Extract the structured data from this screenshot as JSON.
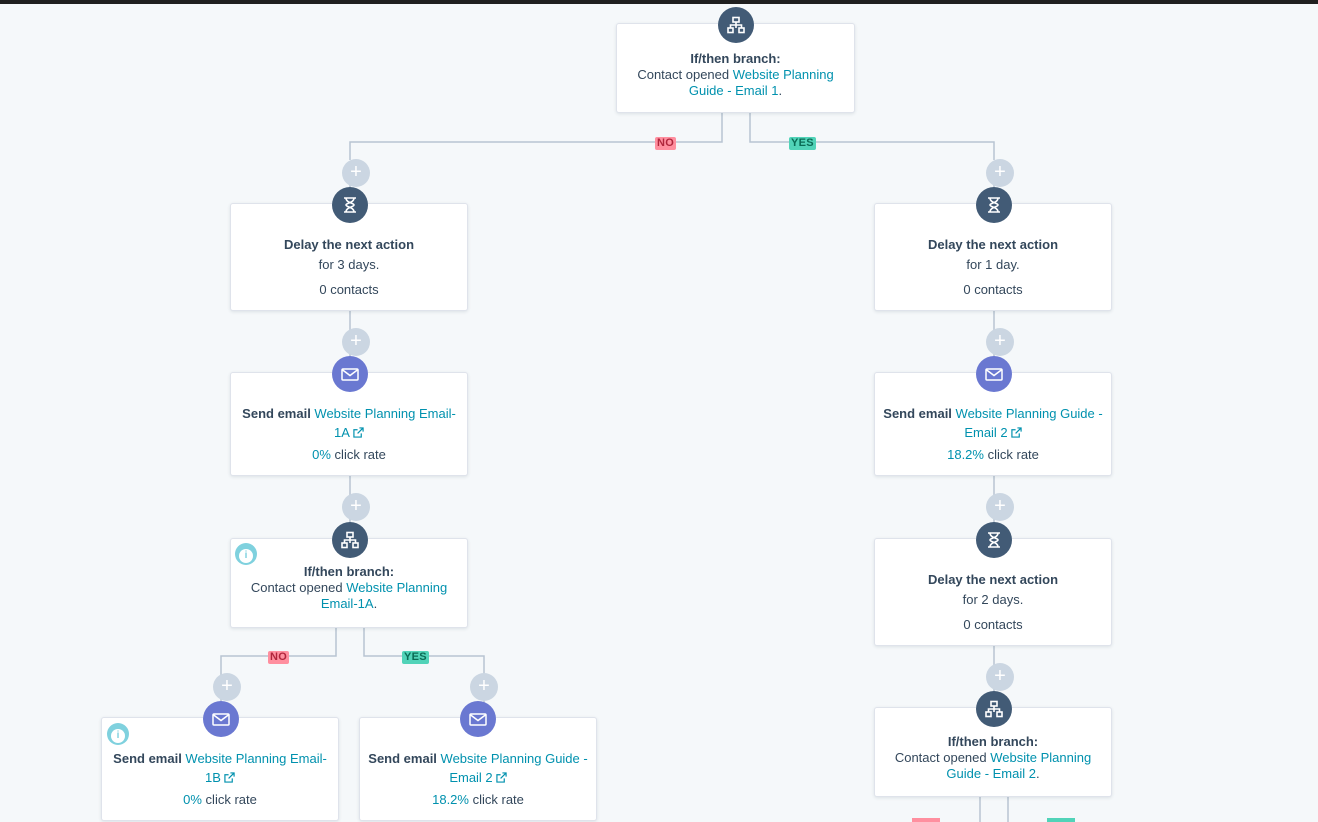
{
  "colors": {
    "canvas": "#f5f8fa",
    "dark_icon": "#425b76",
    "email_icon": "#6a78d1",
    "link": "#0091ae",
    "no_tag": "#ff8f9f",
    "yes_tag": "#51d3b8",
    "plus": "#cbd6e2",
    "info": "#7fd1de"
  },
  "icons": {
    "branch": "branch-icon",
    "delay": "hourglass-icon",
    "email": "envelope-icon",
    "add": "plus-icon",
    "info": "info-icon",
    "external": "external-link-icon"
  },
  "branch_labels": {
    "no": "NO",
    "yes": "YES"
  },
  "top_branch": {
    "title": "If/then branch:",
    "prefix": "Contact opened ",
    "link_line1": "Website Planning",
    "link_line2": "Guide - Email 1",
    "suffix": "."
  },
  "left": {
    "delay": {
      "title": "Delay the next action",
      "detail": "for 3 days.",
      "contacts": "0 contacts"
    },
    "email": {
      "prefix": "Send email ",
      "link_line1": "Website Planning Email-",
      "link_line2": "1A",
      "rate": "0%",
      "rate_label": " click rate"
    },
    "branch": {
      "title": "If/then branch:",
      "prefix": "Contact opened ",
      "link_line1": "Website Planning",
      "link_line2": "Email-1A",
      "suffix": "."
    },
    "no_email": {
      "prefix": "Send email ",
      "link_line1": "Website Planning Email-",
      "link_line2": "1B",
      "rate": "0%",
      "rate_label": " click rate"
    },
    "yes_email": {
      "prefix": "Send email ",
      "link_line1": "Website Planning Guide -",
      "link_line2": "Email 2",
      "rate": "18.2%",
      "rate_label": " click rate"
    }
  },
  "right": {
    "delay1": {
      "title": "Delay the next action",
      "detail": "for 1 day.",
      "contacts": "0 contacts"
    },
    "email": {
      "prefix": "Send email ",
      "link_line1": "Website Planning Guide -",
      "link_line2": "Email 2",
      "rate": "18.2%",
      "rate_label": " click rate"
    },
    "delay2": {
      "title": "Delay the next action",
      "detail": "for 2 days.",
      "contacts": "0 contacts"
    },
    "branch": {
      "title": "If/then branch:",
      "prefix": "Contact opened ",
      "link_line1": "Website Planning",
      "link_line2": "Guide - Email 2",
      "suffix": "."
    }
  },
  "add_symbol": "+",
  "info_symbol": "i"
}
